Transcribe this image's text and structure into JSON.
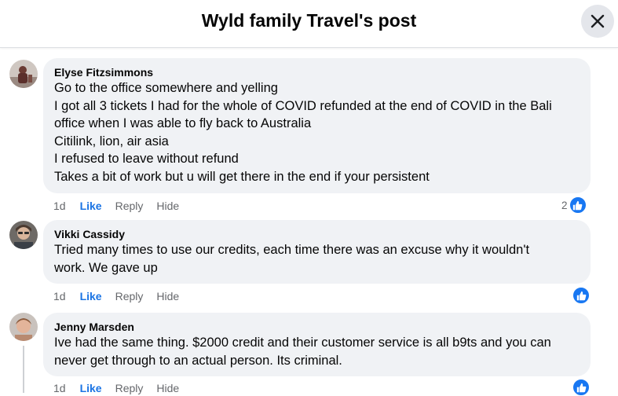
{
  "header": {
    "title": "Wyld family Travel's post"
  },
  "comments": [
    {
      "author": "Elyse Fitzsimmons",
      "lines": [
        "Go to the office somewhere and yelling",
        "I got all 3 tickets I had for the whole of COVID refunded at the end of COVID in the Bali",
        "office when I was able to fly back to Australia",
        "Citilink, lion, air asia",
        "I refused to leave without refund",
        "Takes a bit of work but u will get there in the end if your persistent"
      ],
      "time": "1d",
      "like": "Like",
      "reply": "Reply",
      "hide": "Hide",
      "reaction_count": "2"
    },
    {
      "author": "Vikki Cassidy",
      "lines": [
        "Tried many times to use our credits, each time there was an excuse why it wouldn't",
        "work. We gave up"
      ],
      "time": "1d",
      "like": "Like",
      "reply": "Reply",
      "hide": "Hide",
      "reaction_count": ""
    },
    {
      "author": "Jenny Marsden",
      "lines": [
        "Ive had the same thing. $2000 credit and their customer service is all b9ts and you can",
        "never get through to an actual person. Its criminal."
      ],
      "time": "1d",
      "like": "Like",
      "reply": "Reply",
      "hide": "Hide",
      "reaction_count": ""
    }
  ],
  "colors": {
    "like_blue": "#1b74e4",
    "bubble": "#f0f2f5",
    "meta_gray": "#65676b"
  },
  "icons": [
    "close-icon",
    "like-reaction-icon"
  ]
}
